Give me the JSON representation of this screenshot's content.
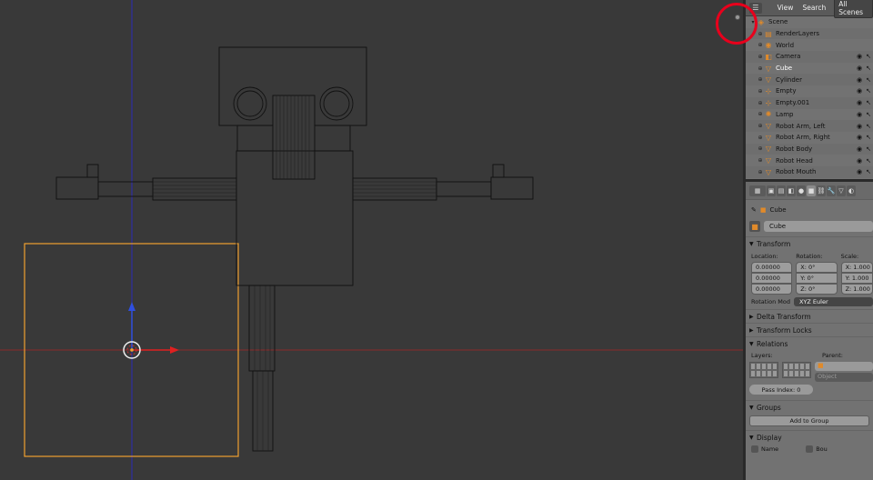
{
  "outliner": {
    "header": {
      "view": "View",
      "search": "Search",
      "scenes": "All Scenes"
    },
    "rows": [
      {
        "name": "Scene",
        "icon": "scene-icon",
        "level": 0
      },
      {
        "name": "RenderLayers",
        "icon": "render-layers-icon",
        "level": 1
      },
      {
        "name": "World",
        "icon": "world-icon",
        "level": 1
      },
      {
        "name": "Camera",
        "icon": "camera-icon",
        "level": 1
      },
      {
        "name": "Cube",
        "icon": "mesh-icon",
        "level": 1,
        "selected": true
      },
      {
        "name": "Cylinder",
        "icon": "mesh-icon",
        "level": 1
      },
      {
        "name": "Empty",
        "icon": "empty-icon",
        "level": 1
      },
      {
        "name": "Empty.001",
        "icon": "empty-icon",
        "level": 1
      },
      {
        "name": "Lamp",
        "icon": "lamp-icon",
        "level": 1
      },
      {
        "name": "Robot Arm, Left",
        "icon": "mesh-icon",
        "level": 1
      },
      {
        "name": "Robot Arm, Right",
        "icon": "mesh-icon",
        "level": 1
      },
      {
        "name": "Robot Body",
        "icon": "mesh-icon",
        "level": 1
      },
      {
        "name": "Robot Head",
        "icon": "mesh-icon",
        "level": 1
      },
      {
        "name": "Robot Mouth",
        "icon": "mesh-icon",
        "level": 1
      }
    ]
  },
  "properties": {
    "breadcrumb": "Cube",
    "object_name": "Cube",
    "transform": {
      "title": "Transform",
      "location_label": "Location:",
      "rotation_label": "Rotation:",
      "scale_label": "Scale:",
      "location": [
        "0.00000",
        "0.00000",
        "0.00000"
      ],
      "rotation": [
        "X: 0°",
        "Y: 0°",
        "Z: 0°"
      ],
      "scale": [
        "X: 1.000",
        "Y: 1.000",
        "Z: 1.000"
      ],
      "rotation_mode_label": "Rotation Mod",
      "rotation_mode_value": "XYZ Euler"
    },
    "panels": {
      "delta_transform": "Delta Transform",
      "transform_locks": "Transform Locks",
      "relations": "Relations",
      "layers_label": "Layers:",
      "parent_label": "Parent:",
      "parent_type": "Object",
      "pass_index": "Pass Index: 0",
      "groups": "Groups",
      "add_to_group": "Add to Group",
      "display": "Display",
      "name_check": "Name",
      "bounds_check": "Bou"
    }
  },
  "colors": {
    "viewport_bg": "#393939",
    "selection_outline": "#f0a030",
    "x_axis": "#b03030",
    "y_axis": "#3030c0",
    "annotation": "#e8001c"
  }
}
